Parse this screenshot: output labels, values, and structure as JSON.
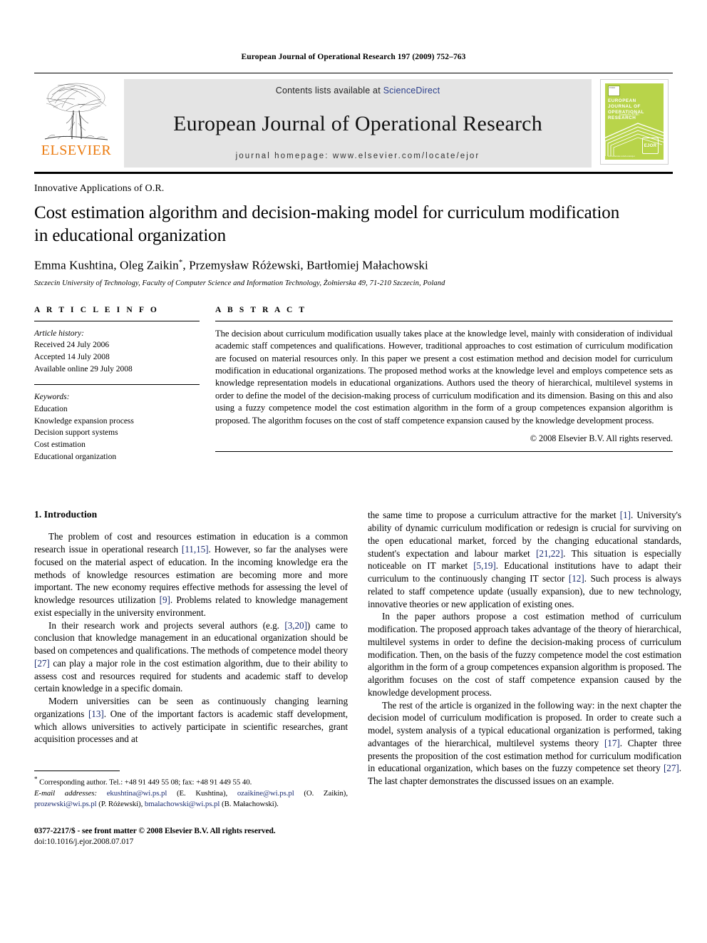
{
  "running_head": "European Journal of Operational Research 197 (2009) 752–763",
  "masthead": {
    "publisher_name": "ELSEVIER",
    "contents_prefix": "Contents lists available at",
    "sciencedirect": "ScienceDirect",
    "journal_title": "European Journal of Operational Research",
    "homepage": "journal homepage: www.elsevier.com/locate/ejor",
    "cover": {
      "title": "EUROPEAN JOURNAL OF OPERATIONAL RESEARCH",
      "subtitle_line1": "Founded by EURO",
      "subtitle_line2": "The Association of European Operational Research Societies",
      "footer_url": "www.elsevier.com/locate/ejor",
      "badge": "EJOR",
      "accent_color": "#b8d44a"
    }
  },
  "article": {
    "section_label": "Innovative Applications of O.R.",
    "title": "Cost estimation algorithm and decision-making model for curriculum modification in educational organization",
    "authors": "Emma Kushtina, Oleg Zaikin",
    "authors_rest": ", Przemysław Różewski, Bartłomiej Małachowski",
    "corresponding_marker": "*",
    "affiliation": "Szczecin University of Technology, Faculty of Computer Science and Information Technology, Żołnierska 49, 71-210 Szczecin, Poland"
  },
  "article_info": {
    "heading": "A R T I C L E   I N F O",
    "history_label": "Article history:",
    "history": [
      "Received 24 July 2006",
      "Accepted 14 July 2008",
      "Available online 29 July 2008"
    ],
    "keywords_label": "Keywords:",
    "keywords": [
      "Education",
      "Knowledge expansion process",
      "Decision support systems",
      "Cost estimation",
      "Educational organization"
    ]
  },
  "abstract": {
    "heading": "A B S T R A C T",
    "text": "The decision about curriculum modification usually takes place at the knowledge level, mainly with consideration of individual academic staff competences and qualifications. However, traditional approaches to cost estimation of curriculum modification are focused on material resources only. In this paper we present a cost estimation method and decision model for curriculum modification in educational organizations. The proposed method works at the knowledge level and employs competence sets as knowledge representation models in educational organizations. Authors used the theory of hierarchical, multilevel systems in order to define the model of the decision-making process of curriculum modification and its dimension. Basing on this and also using a fuzzy competence model the cost estimation algorithm in the form of a group competences expansion algorithm is proposed. The algorithm focuses on the cost of staff competence expansion caused by the knowledge development process.",
    "copyright": "© 2008 Elsevier B.V. All rights reserved."
  },
  "body": {
    "section_heading": "1. Introduction",
    "left_paragraphs": [
      {
        "segments": [
          {
            "t": "The problem of cost and resources estimation in education is a common research issue in operational research "
          },
          {
            "t": "[11,15]",
            "ref": true
          },
          {
            "t": ". However, so far the analyses were focused on the material aspect of education. In the incoming knowledge era the methods of knowledge resources estimation are becoming more and more important. The new economy requires effective methods for assessing the level of knowledge resources utilization "
          },
          {
            "t": "[9]",
            "ref": true
          },
          {
            "t": ". Problems related to knowledge management exist especially in the university environment."
          }
        ]
      },
      {
        "segments": [
          {
            "t": "In their research work and projects several authors (e.g. "
          },
          {
            "t": "[3,20]",
            "ref": true
          },
          {
            "t": ") came to conclusion that knowledge management in an educational organization should be based on competences and qualifications. The methods of competence model theory "
          },
          {
            "t": "[27]",
            "ref": true
          },
          {
            "t": " can play a major role in the cost estimation algorithm, due to their ability to assess cost and resources required for students and academic staff to develop certain knowledge in a specific domain."
          }
        ]
      },
      {
        "segments": [
          {
            "t": "Modern universities can be seen as continuously changing learning organizations "
          },
          {
            "t": "[13]",
            "ref": true
          },
          {
            "t": ". One of the important factors is academic staff development, which allows universities to actively participate in scientific researches, grant acquisition processes and at"
          }
        ]
      }
    ],
    "right_paragraphs": [
      {
        "first": false,
        "segments": [
          {
            "t": "the same time to propose a curriculum attractive for the market "
          },
          {
            "t": "[1]",
            "ref": true
          },
          {
            "t": ". University's ability of dynamic curriculum modification or redesign is crucial for surviving on the open educational market, forced by the changing educational standards, student's expectation and labour market "
          },
          {
            "t": "[21,22]",
            "ref": true
          },
          {
            "t": ". This situation is especially noticeable on IT market "
          },
          {
            "t": "[5,19]",
            "ref": true
          },
          {
            "t": ". Educational institutions have to adapt their curriculum to the continuously changing IT sector "
          },
          {
            "t": "[12]",
            "ref": true
          },
          {
            "t": ". Such process is always related to staff competence update (usually expansion), due to new technology, innovative theories or new application of existing ones."
          }
        ]
      },
      {
        "first": true,
        "segments": [
          {
            "t": "In the paper authors propose a cost estimation method of curriculum modification. The proposed approach takes advantage of the theory of hierarchical, multilevel systems in order to define the decision-making process of curriculum modification. Then, on the basis of the fuzzy competence model the cost estimation algorithm in the form of a group competences expansion algorithm is proposed. The algorithm focuses on the cost of staff competence expansion caused by the knowledge development process."
          }
        ]
      },
      {
        "first": true,
        "segments": [
          {
            "t": "The rest of the article is organized in the following way: in the next chapter the decision model of curriculum modification is proposed. In order to create such a model, system analysis of a typical educational organization is performed, taking advantages of the hierarchical, multilevel systems theory "
          },
          {
            "t": "[17]",
            "ref": true
          },
          {
            "t": ". Chapter three presents the proposition of the cost estimation method for curriculum modification in educational organization, which bases on the fuzzy competence set theory "
          },
          {
            "t": "[27]",
            "ref": true
          },
          {
            "t": ". The last chapter demonstrates the discussed issues on an example."
          }
        ]
      }
    ]
  },
  "footnote": {
    "corresponding": "Corresponding author. Tel.: +48 91 449 55 08; fax: +48 91 449 55 40.",
    "email_label": "E-mail addresses:",
    "emails": [
      {
        "address": "ekushtina@wi.ps.pl",
        "name": "(E. Kushtina)"
      },
      {
        "address": "ozaikine@wi.ps.pl",
        "name": "(O. Zaikin)"
      },
      {
        "address": "prozewski@wi.ps.pl",
        "name": "(P. Różewski)"
      },
      {
        "address": "bmalachowski@wi.ps.pl",
        "name": "(B. Małachowski)"
      }
    ],
    "issn_line": "0377-2217/$ - see front matter © 2008 Elsevier B.V. All rights reserved.",
    "doi_line": "doi:10.1016/j.ejor.2008.07.017"
  }
}
